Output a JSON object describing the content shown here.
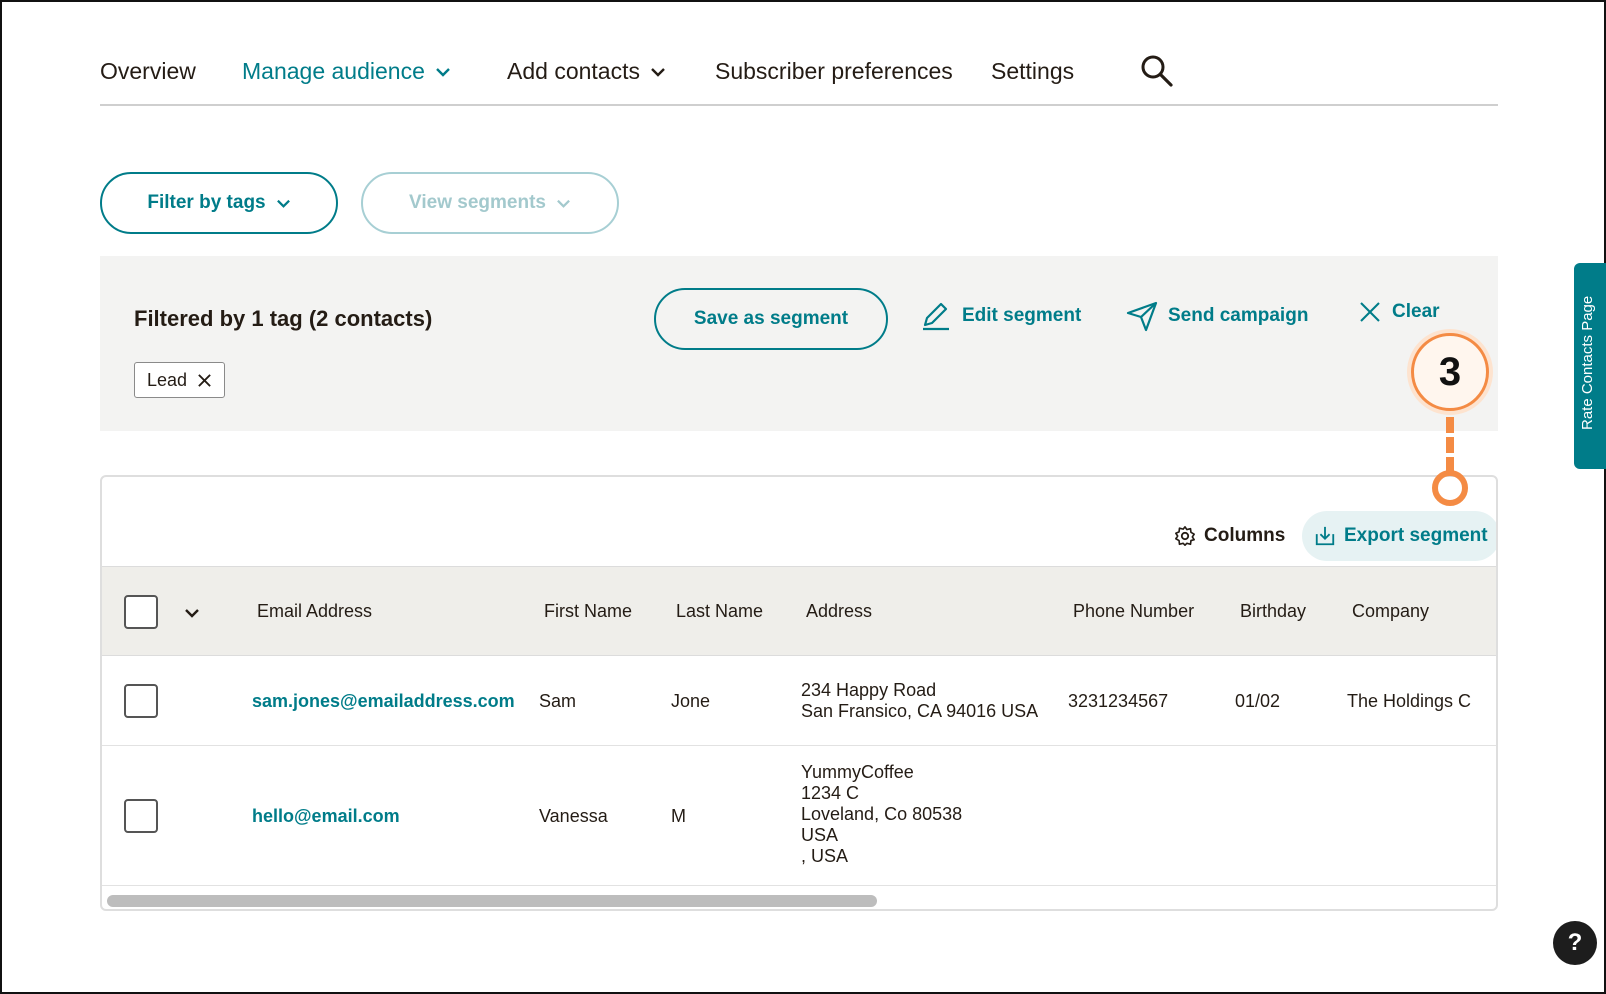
{
  "nav": {
    "overview": "Overview",
    "manage_audience": "Manage audience",
    "add_contacts": "Add contacts",
    "subscriber_preferences": "Subscriber preferences",
    "settings": "Settings"
  },
  "filters": {
    "filter_by_tags": "Filter by tags",
    "view_segments": "View segments"
  },
  "panel": {
    "title": "Filtered by 1 tag (2 contacts)",
    "tag_label": "Lead",
    "save_as_segment": "Save as segment",
    "edit_segment": "Edit segment",
    "send_campaign": "Send campaign",
    "clear": "Clear"
  },
  "toolbar": {
    "columns": "Columns",
    "export_segment": "Export segment"
  },
  "table": {
    "headers": [
      "Email Address",
      "First Name",
      "Last Name",
      "Address",
      "Phone Number",
      "Birthday",
      "Company"
    ],
    "rows": [
      {
        "email": "sam.jones@emailaddress.com",
        "first_name": "Sam",
        "last_name": "Jone",
        "address_lines": [
          "234 Happy Road",
          "San Fransico, CA 94016 USA"
        ],
        "phone": "3231234567",
        "birthday": "01/02",
        "company": "The Holdings C"
      },
      {
        "email": "hello@email.com",
        "first_name": "Vanessa",
        "last_name": "M",
        "address_lines": [
          "YummyCoffee",
          "1234 C",
          "Loveland, Co 80538",
          "USA",
          ", USA"
        ],
        "phone": "",
        "birthday": "",
        "company": ""
      }
    ]
  },
  "step_marker": "3",
  "side_tab": "Rate Contacts Page",
  "help": "?",
  "colors": {
    "accent": "#007c89",
    "marker": "#f48b44",
    "text": "#241c15"
  }
}
